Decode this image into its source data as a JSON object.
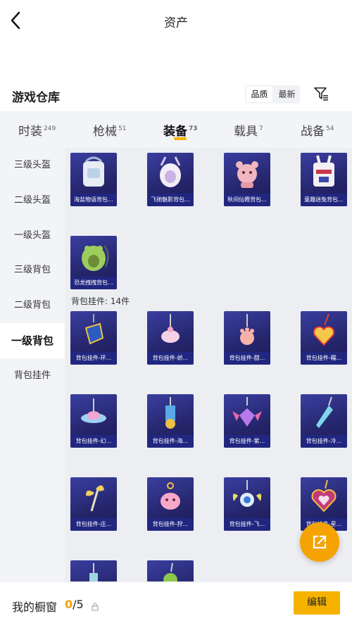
{
  "header": {
    "title": "资产"
  },
  "warehouse": {
    "title": "游戏仓库",
    "sort_options": [
      "品质",
      "最新"
    ],
    "active_sort": "品质"
  },
  "tabs": [
    {
      "label": "时装",
      "count": "249"
    },
    {
      "label": "枪械",
      "count": "51"
    },
    {
      "label": "装备",
      "count": "73",
      "active": true
    },
    {
      "label": "载具",
      "count": "7"
    },
    {
      "label": "战备",
      "count": "54"
    }
  ],
  "sidebar": {
    "items": [
      "三级头盔",
      "二级头盔",
      "一级头盔",
      "三级背包",
      "二级背包",
      "一级背包",
      "背包挂件"
    ],
    "active": "一级背包"
  },
  "backpacks": [
    {
      "name": "海盐物语背包..."
    },
    {
      "name": "飞驰魅影背包..."
    },
    {
      "name": "秋间仙霞背包..."
    },
    {
      "name": "童趣迷兔背包..."
    },
    {
      "name": "恐龙拽拽背包..."
    }
  ],
  "pendant_section": {
    "label": "背包挂件: 14件"
  },
  "pendants": [
    {
      "name": "背包挂件-环..."
    },
    {
      "name": "背包挂件-娇..."
    },
    {
      "name": "背包挂件-甜..."
    },
    {
      "name": "背包挂件-糯..."
    },
    {
      "name": "背包挂件-幻..."
    },
    {
      "name": "背包挂件-海..."
    },
    {
      "name": "背包挂件-紫..."
    },
    {
      "name": "背包挂件-冷..."
    },
    {
      "name": "背包挂件-庄..."
    },
    {
      "name": "背包挂件-狩..."
    },
    {
      "name": "背包挂件-飞..."
    },
    {
      "name": "背包挂件-星..."
    },
    {
      "name": ""
    },
    {
      "name": ""
    }
  ],
  "bottom": {
    "label": "我的橱窗",
    "current": "0",
    "total": "/5",
    "edit_label": "编辑"
  },
  "colors": {
    "accent": "#f5b300",
    "card_bg": "#25256b",
    "caption_bg": "#222882"
  },
  "icons": [
    "back-arrow-icon",
    "filter-icon",
    "share-icon",
    "lock-icon"
  ]
}
